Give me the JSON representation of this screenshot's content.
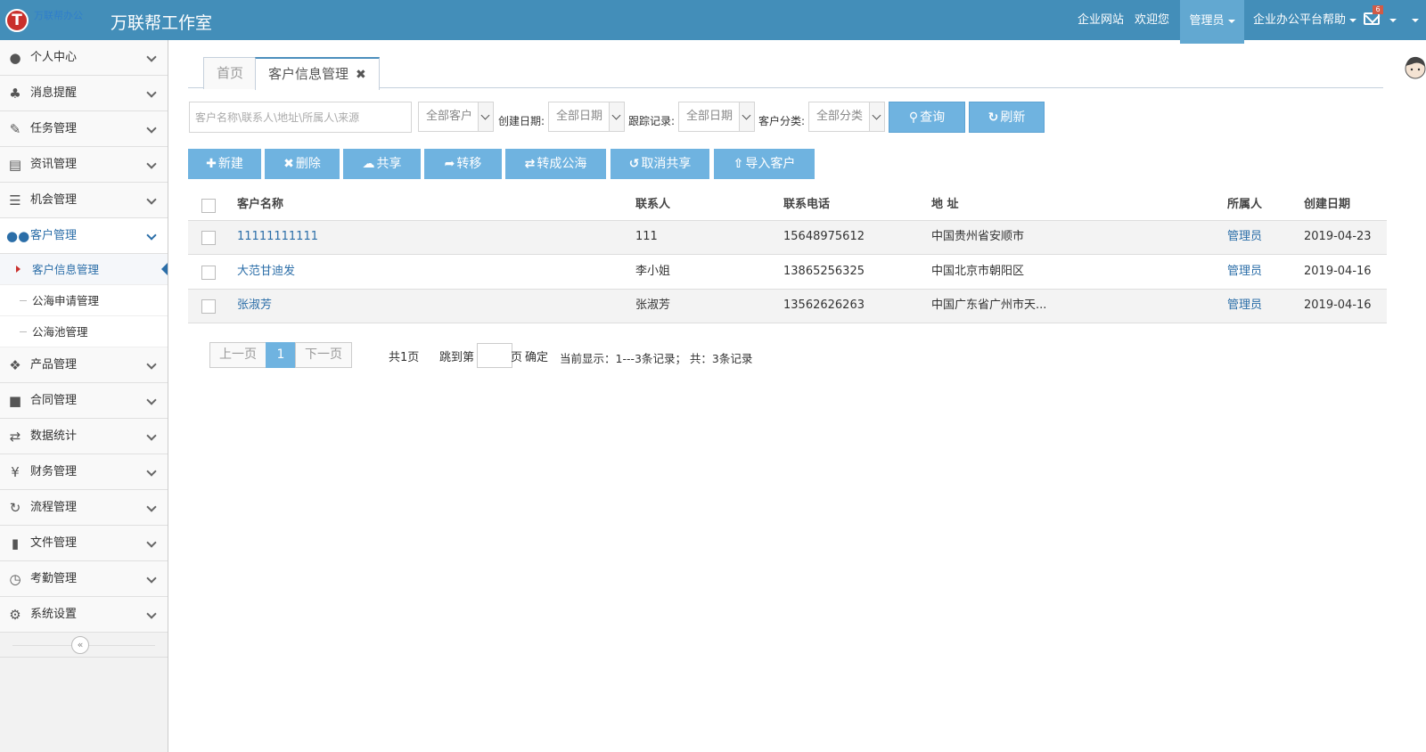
{
  "header": {
    "logo_letter": "T",
    "logo_text": "万联帮办公",
    "app_title": "万联帮工作室",
    "nav": [
      "企业网站",
      "欢迎您"
    ],
    "user": "管理员",
    "help": "企业办公平台帮助",
    "mail_count": "6"
  },
  "sidebar": {
    "items": [
      {
        "label": "个人中心",
        "icon": "user-icon"
      },
      {
        "label": "消息提醒",
        "icon": "bell-icon"
      },
      {
        "label": "任务管理",
        "icon": "edit-icon"
      },
      {
        "label": "资讯管理",
        "icon": "document-icon"
      },
      {
        "label": "机会管理",
        "icon": "list-icon"
      },
      {
        "label": "客户管理",
        "icon": "users-icon"
      },
      {
        "label": "产品管理",
        "icon": "dropbox-icon"
      },
      {
        "label": "合同管理",
        "icon": "folder-open-icon"
      },
      {
        "label": "数据统计",
        "icon": "random-icon"
      },
      {
        "label": "财务管理",
        "icon": "yen-icon"
      },
      {
        "label": "流程管理",
        "icon": "retweet-icon"
      },
      {
        "label": "文件管理",
        "icon": "file-icon"
      },
      {
        "label": "考勤管理",
        "icon": "clock-icon"
      },
      {
        "label": "系统设置",
        "icon": "gear-icon"
      }
    ],
    "sub_items": [
      "客户信息管理",
      "公海申请管理",
      "公海池管理"
    ]
  },
  "tabs": [
    {
      "label": "首页"
    },
    {
      "label": "客户信息管理"
    }
  ],
  "filters": {
    "search_placeholder": "客户名称\\联系人\\地址\\所属人\\来源",
    "customer_select": "全部客户",
    "create_date_label": "创建日期:",
    "create_date_select": "全部日期",
    "follow_label": "跟踪记录:",
    "follow_select": "全部日期",
    "category_label": "客户分类:",
    "category_select": "全部分类",
    "query": "查询",
    "refresh": "刷新"
  },
  "actions": [
    "新建",
    "删除",
    "共享",
    "转移",
    "转成公海",
    "取消共享",
    "导入客户"
  ],
  "table": {
    "headers": [
      "客户名称",
      "联系人",
      "联系电话",
      "地 址",
      "所属人",
      "创建日期"
    ],
    "rows": [
      [
        "11111111111",
        "111",
        "15648975612",
        "中国贵州省安顺市",
        "管理员",
        "2019-04-23"
      ],
      [
        "大范甘迪发",
        "李小姐",
        "13865256325",
        "中国北京市朝阳区",
        "管理员",
        "2019-04-16"
      ],
      [
        "张淑芳",
        "张淑芳",
        "13562626263",
        "中国广东省广州市天...",
        "管理员",
        "2019-04-16"
      ]
    ]
  },
  "pagination": {
    "prev": "上一页",
    "current": "1",
    "next": "下一页",
    "total_pages": "共1页",
    "jump_label": "跳到第",
    "page_unit": "页",
    "confirm": "确定",
    "showing": "当前显示：1---3条记录；  共：3条记录"
  }
}
